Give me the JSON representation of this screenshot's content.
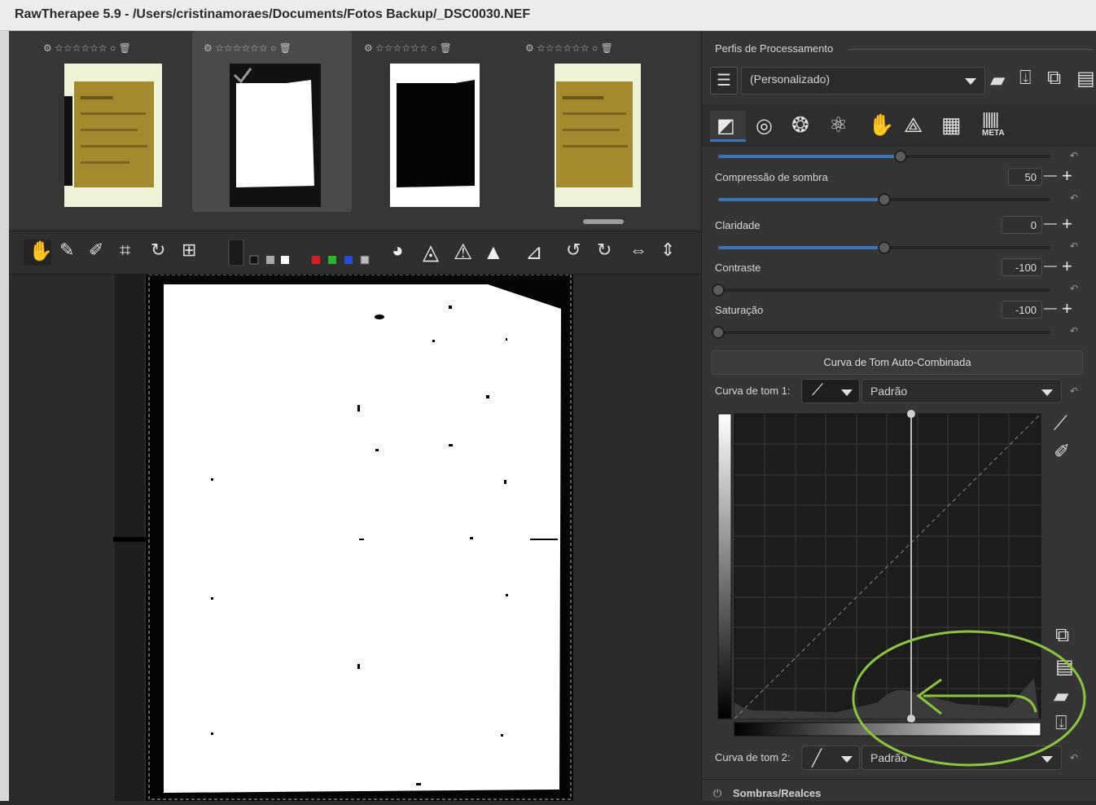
{
  "window": {
    "title": "RawTherapee 5.9 - /Users/cristinamoraes/Documents/Fotos Backup/_DSC0030.NEF"
  },
  "filmstrip": {
    "thumbnails": [
      {
        "stars": "☆☆☆☆☆☆",
        "kind": "color"
      },
      {
        "stars": "☆☆☆☆☆☆",
        "kind": "bw-white",
        "selected": true
      },
      {
        "stars": "☆☆☆☆☆☆",
        "kind": "bw-black"
      },
      {
        "stars": "☆☆☆☆☆☆",
        "kind": "color"
      }
    ]
  },
  "panel": {
    "profiles_title": "Perfis de Processamento",
    "profile_value": "(Personalizado)",
    "tabs": [
      "exposure-tab-icon",
      "detail-tab-icon",
      "color-tab-icon",
      "advanced-tab-icon",
      "locallab-tab-icon",
      "transform-tab-icon",
      "raw-tab-icon",
      "metadata-tab-icon"
    ],
    "meta_label": "META",
    "sliders": [
      {
        "label": "Compressão de sombra",
        "value": "50",
        "fraction": 0.5
      },
      {
        "label": "Claridade",
        "value": "0",
        "fraction": 0.5
      },
      {
        "label": "Contraste",
        "value": "-100",
        "fraction": 0.0
      },
      {
        "label": "Saturação",
        "value": "-100",
        "fraction": 0.0
      }
    ],
    "top_slider_fraction": 0.55,
    "curve_section_button": "Curva de Tom Auto-Combinada",
    "curve1_label": "Curva de tom 1:",
    "curve1_mode": "Padrão",
    "curve2_label": "Curva de tom 2:",
    "curve2_mode": "Padrão",
    "next_section": "Sombras/Realces"
  },
  "colors": {
    "accent": "#3b74b8",
    "annotation": "#8cc63f"
  }
}
